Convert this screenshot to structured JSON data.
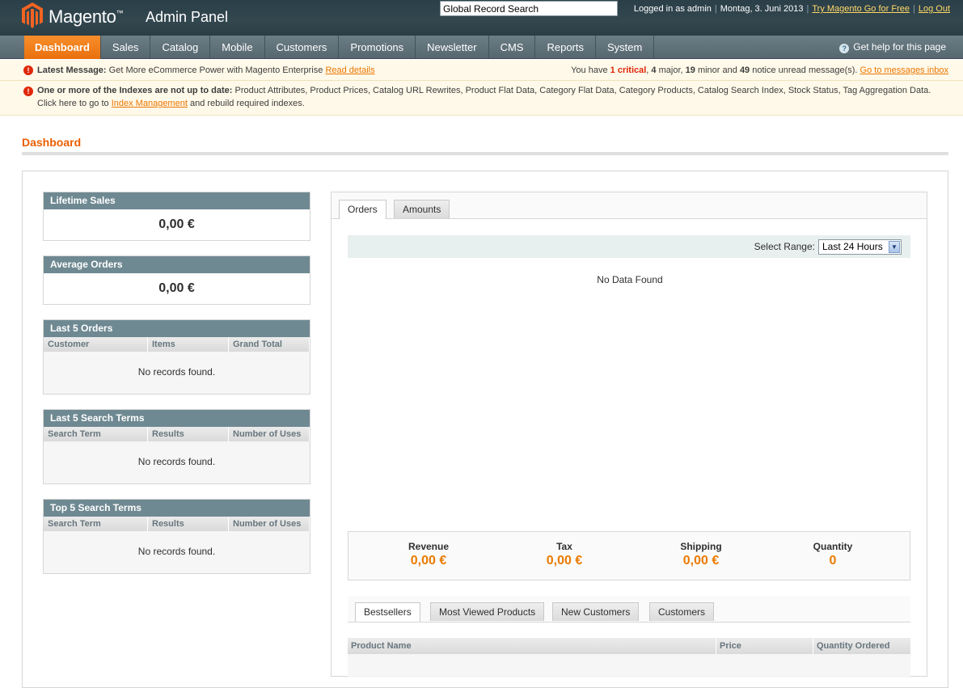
{
  "header": {
    "brand": "Magento",
    "brand_tm": "™",
    "subtitle": "Admin Panel",
    "search_value": "Global Record Search",
    "logged_in": "Logged in as admin",
    "date": "Montag, 3. Juni 2013",
    "try_link": "Try Magento Go for Free",
    "logout": "Log Out"
  },
  "nav": {
    "items": [
      "Dashboard",
      "Sales",
      "Catalog",
      "Mobile",
      "Customers",
      "Promotions",
      "Newsletter",
      "CMS",
      "Reports",
      "System"
    ],
    "help": "Get help for this page"
  },
  "notices": {
    "latest_label": "Latest Message:",
    "latest_text": "Get More eCommerce Power with Magento Enterprise",
    "read_details": "Read details",
    "you_have": "You have",
    "critical": "1 critical",
    "major_count": "4",
    "major_text": "major,",
    "minor_count": "19",
    "minor_text": "minor and",
    "notice_count": "49",
    "notice_text": "notice unread message(s).",
    "inbox_link": "Go to messages inbox",
    "index_bold": "One or more of the Indexes are not up to date:",
    "index_list": "Product Attributes, Product Prices, Catalog URL Rewrites, Product Flat Data, Category Flat Data, Category Products, Catalog Search Index, Stock Status, Tag Aggregation Data.",
    "click_here": "Click here to go to",
    "index_link": "Index Management",
    "rebuild": "and rebuild required indexes."
  },
  "page": {
    "title": "Dashboard"
  },
  "sidebar": {
    "lifetime_sales": {
      "title": "Lifetime Sales",
      "value": "0,00 €"
    },
    "average_orders": {
      "title": "Average Orders",
      "value": "0,00 €"
    },
    "last_orders": {
      "title": "Last 5 Orders",
      "columns": [
        "Customer",
        "Items",
        "Grand Total"
      ],
      "empty": "No records found."
    },
    "last_search": {
      "title": "Last 5 Search Terms",
      "columns": [
        "Search Term",
        "Results",
        "Number of Uses"
      ],
      "empty": "No records found."
    },
    "top_search": {
      "title": "Top 5 Search Terms",
      "columns": [
        "Search Term",
        "Results",
        "Number of Uses"
      ],
      "empty": "No records found."
    }
  },
  "chart": {
    "tabs": [
      "Orders",
      "Amounts"
    ],
    "range_label": "Select Range:",
    "range_value": "Last 24 Hours",
    "no_data": "No Data Found"
  },
  "totals": [
    {
      "label": "Revenue",
      "value": "0,00 €"
    },
    {
      "label": "Tax",
      "value": "0,00 €"
    },
    {
      "label": "Shipping",
      "value": "0,00 €"
    },
    {
      "label": "Quantity",
      "value": "0"
    }
  ],
  "bottom_tabs": [
    "Bestsellers",
    "Most Viewed Products",
    "New Customers",
    "Customers"
  ],
  "product_grid": {
    "columns": [
      "Product Name",
      "Price",
      "Quantity Ordered"
    ]
  },
  "colors": {
    "accent": "#eb5e00",
    "header_bg": "#2b3f49",
    "nav_active": "#f98e2c",
    "critical": "#df280a"
  }
}
